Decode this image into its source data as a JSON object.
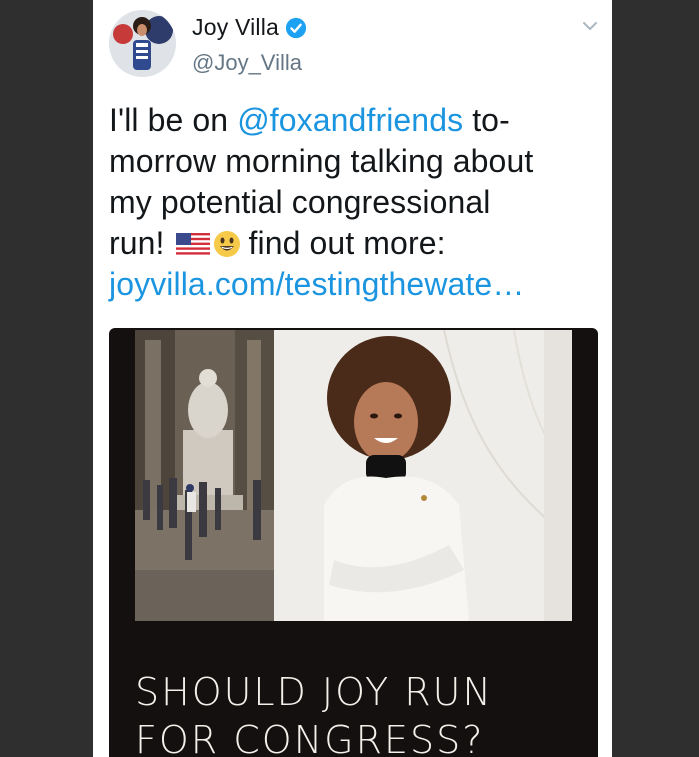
{
  "user": {
    "display_name": "Joy Villa",
    "handle": "@Joy_Villa",
    "verified": true,
    "avatar_icon": "avatar-photo"
  },
  "tweet": {
    "line1_a": "I'll be on ",
    "mention": "@foxandfriends",
    "line1_b": " to-",
    "line2": "morrow morning talking about",
    "line3": "my potential congressional",
    "line4_a": "run!",
    "line4_b": "find out more:",
    "link": "joyvilla.com/testingthewate…",
    "emojis": [
      "us-flag-icon",
      "grinning-face-icon"
    ]
  },
  "media": {
    "caption_line1": "SHOULD JOY RUN",
    "caption_line2": "FOR CONGRESS?"
  },
  "colors": {
    "link": "#1b95e0",
    "text": "#14171a",
    "muted": "#657786",
    "verified": "#1da1f2"
  }
}
